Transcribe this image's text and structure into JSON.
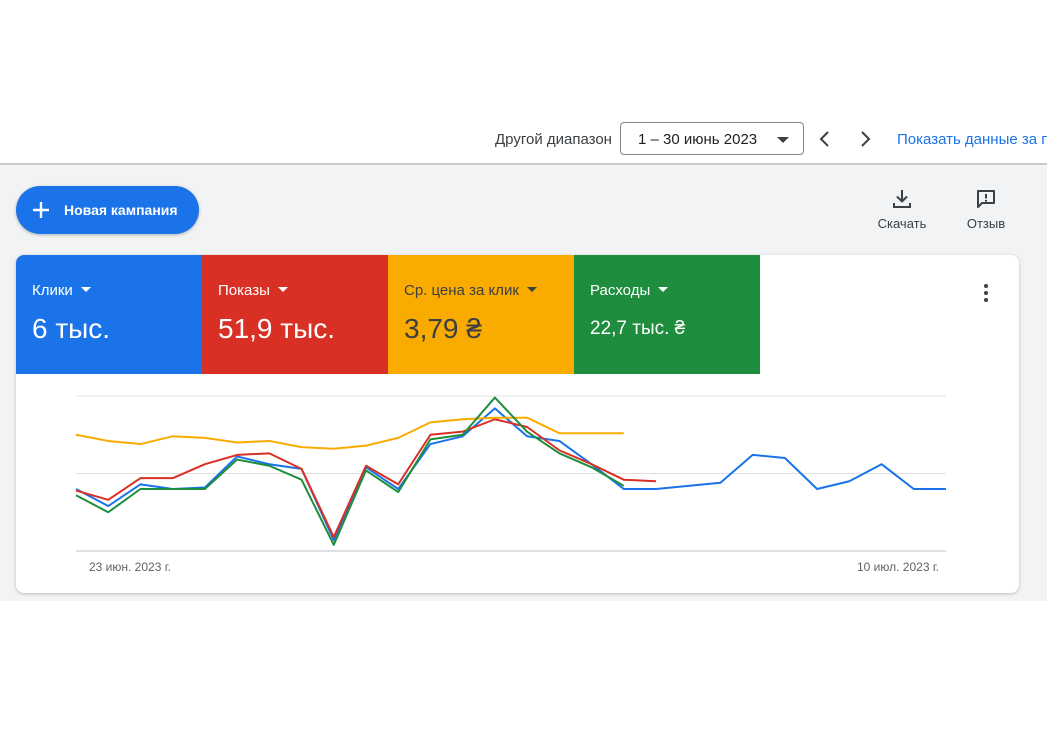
{
  "header": {
    "range_label": "Другой диапазон",
    "range_value": "1 – 30 июнь 2023",
    "show_data_link": "Показать данные за п"
  },
  "toolbar": {
    "new_campaign_label": "Новая кампания",
    "download_label": "Скачать",
    "feedback_label": "Отзыв"
  },
  "metrics": [
    {
      "label": "Клики",
      "value": "6 тыс.",
      "color": "#1a73e8"
    },
    {
      "label": "Показы",
      "value": "51,9 тыс.",
      "color": "#d93025"
    },
    {
      "label": "Ср. цена за клик",
      "value": "3,79 ₴",
      "color": "#f9ab00"
    },
    {
      "label": "Расходы",
      "value": "22,7 тыс. ₴",
      "color": "#1e8e3e"
    }
  ],
  "chart_data": {
    "type": "line",
    "x": [
      "23 июн. 2023 г.",
      "",
      "",
      "",
      "",
      "",
      "",
      "",
      "",
      "",
      "",
      "",
      "",
      "",
      "",
      "",
      "",
      "",
      "",
      "",
      "",
      "",
      "",
      "",
      "",
      "",
      "",
      "10 июл. 2023 г."
    ],
    "x_first_label": "23 июн. 2023 г.",
    "x_last_label": "10 июл. 2023 г.",
    "grid": true,
    "ylim": [
      0,
      100
    ],
    "series": [
      {
        "color": "#1a73e8",
        "values": [
          40,
          29,
          43,
          40,
          41,
          61,
          56,
          53,
          7,
          54,
          40,
          69,
          74,
          92,
          74,
          71,
          56,
          40,
          40,
          42,
          44,
          62,
          60,
          40,
          45,
          56,
          40,
          40
        ]
      },
      {
        "color": "#d93025",
        "values": [
          39,
          33,
          47,
          47,
          56,
          62,
          63,
          53,
          9,
          55,
          43,
          75,
          77,
          85,
          80,
          65,
          56,
          46,
          45
        ]
      },
      {
        "color": "#f9ab00",
        "values": [
          75,
          71,
          69,
          74,
          73,
          70,
          71,
          67,
          66,
          68,
          73,
          83,
          85,
          86,
          86,
          76,
          76,
          76
        ]
      },
      {
        "color": "#1e8e3e",
        "values": [
          36,
          25,
          40,
          40,
          40,
          59,
          55,
          46,
          4,
          52,
          38,
          72,
          75,
          99,
          77,
          63,
          54,
          42
        ]
      }
    ]
  }
}
